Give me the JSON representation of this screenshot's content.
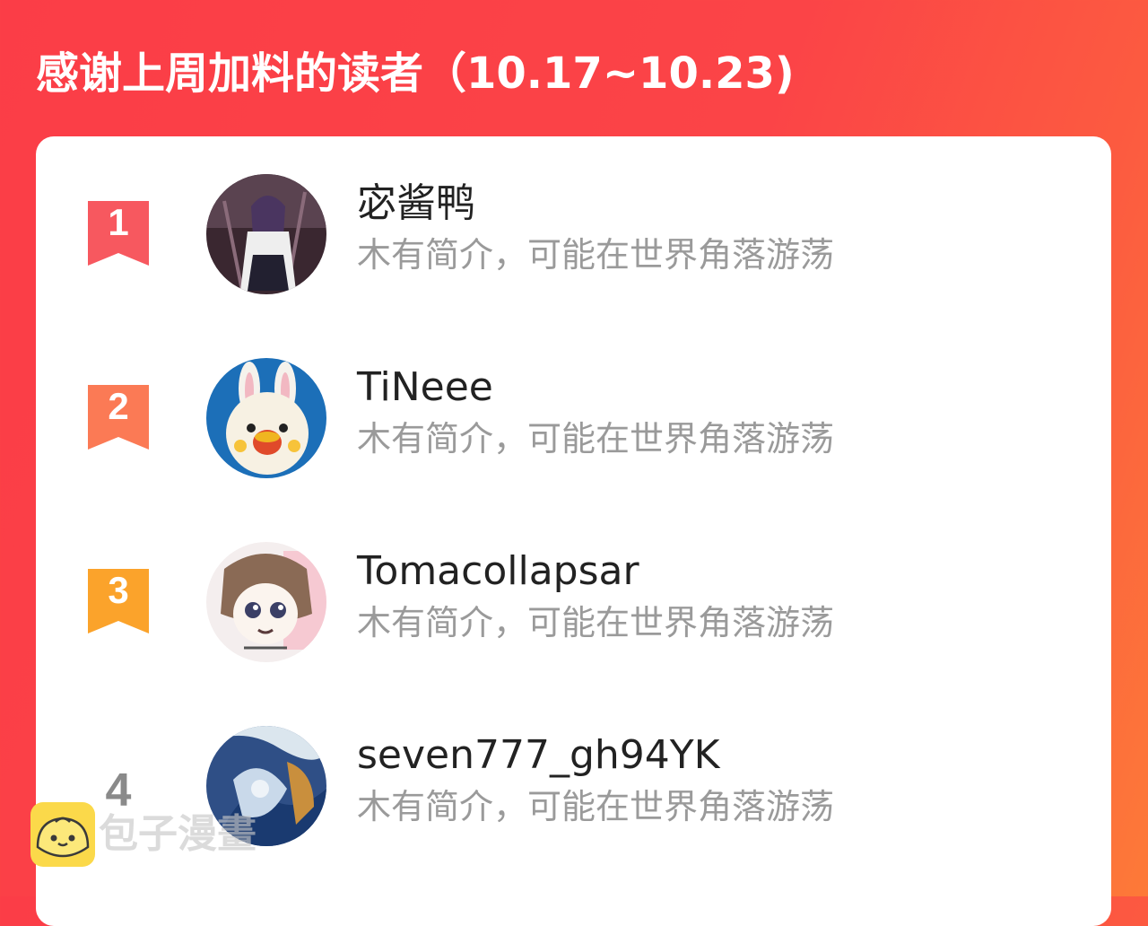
{
  "header": {
    "title": "感谢上周加料的读者（10.17~10.23)"
  },
  "readers": [
    {
      "rank": "1",
      "name": "宓酱鸭",
      "bio": "木有简介，可能在世界角落游荡",
      "badge_color": "#f7585f"
    },
    {
      "rank": "2",
      "name": "TiNeee",
      "bio": "木有简介，可能在世界角落游荡",
      "badge_color": "#fb7a55"
    },
    {
      "rank": "3",
      "name": "Tomacollapsar",
      "bio": "木有简介，可能在世界角落游荡",
      "badge_color": "#fba32b"
    },
    {
      "rank": "4",
      "name": "seven777_gh94YK",
      "bio": "木有简介，可能在世界角落游荡"
    }
  ],
  "watermark": {
    "text": "包子漫畫",
    "logo_icon": "bun-logo-icon"
  }
}
